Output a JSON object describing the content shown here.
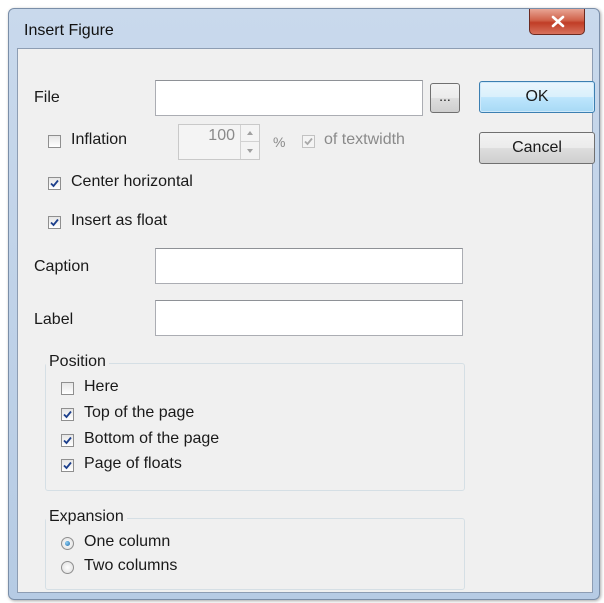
{
  "window": {
    "title": "Insert Figure"
  },
  "file": {
    "label": "File",
    "value": "",
    "browse_label": "..."
  },
  "buttons": {
    "ok": "OK",
    "cancel": "Cancel"
  },
  "inflation": {
    "label": "Inflation",
    "checked": false,
    "value": "100",
    "unit": "%",
    "textwidth_label": "of textwidth",
    "textwidth_checked": true
  },
  "options": {
    "center_horizontal": {
      "label": "Center horizontal",
      "checked": true
    },
    "insert_as_float": {
      "label": "Insert as float",
      "checked": true
    }
  },
  "caption": {
    "label": "Caption",
    "value": ""
  },
  "label_field": {
    "label": "Label",
    "value": ""
  },
  "position": {
    "title": "Position",
    "items": [
      {
        "label": "Here",
        "checked": false
      },
      {
        "label": "Top of the page",
        "checked": true
      },
      {
        "label": "Bottom of the page",
        "checked": true
      },
      {
        "label": "Page of floats",
        "checked": true
      }
    ]
  },
  "expansion": {
    "title": "Expansion",
    "items": [
      {
        "label": "One column",
        "selected": true
      },
      {
        "label": "Two columns",
        "selected": false
      }
    ]
  },
  "icons": {
    "close": "close-icon",
    "check": "checkmark-icon",
    "spin_up": "spin-up-icon",
    "spin_down": "spin-down-icon"
  }
}
